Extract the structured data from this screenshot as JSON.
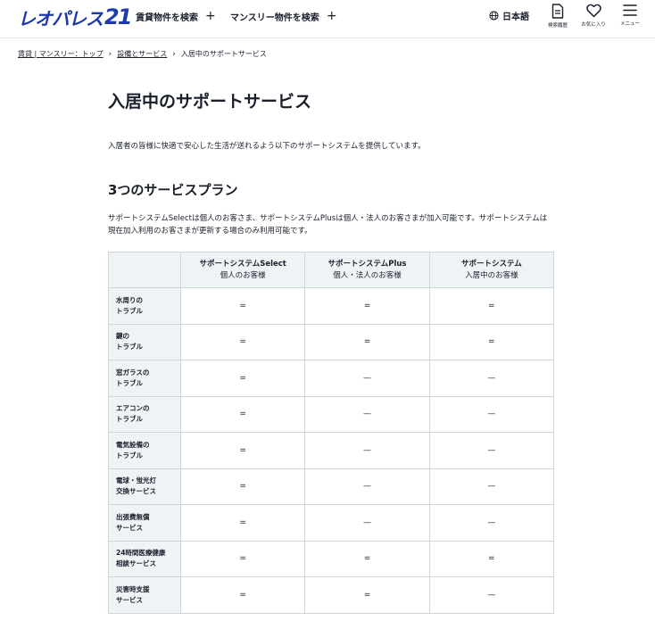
{
  "header": {
    "logo_text": "レオパレス",
    "logo_num": "21",
    "nav": [
      {
        "label": "賃貸物件を検索",
        "icon": "plus-icon",
        "plus": "+"
      },
      {
        "label": "マンスリー物件を検索",
        "icon": "plus-icon",
        "plus": "+"
      }
    ],
    "lang_label": "日本語",
    "icons": [
      {
        "name": "search-history-icon",
        "caption": "検索履歴"
      },
      {
        "name": "favorites-icon",
        "caption": "お気に入り"
      },
      {
        "name": "menu-icon",
        "caption": "メニュー"
      }
    ]
  },
  "breadcrumb": [
    {
      "label": "賃貸 | マンスリー：トップ",
      "link": true
    },
    {
      "label": "設備とサービス",
      "link": true
    },
    {
      "label": "入居中のサポートサービス",
      "link": false
    }
  ],
  "breadcrumb_sep": "›",
  "main": {
    "title": "入居中のサポートサービス",
    "intro": "入居者の皆様に快適で安心した生活が送れるよう以下のサポートシステムを提供しています。",
    "section_title": "3つのサービスプラン",
    "description": "サポートシステムSelectは個人のお客さま、サポートシステムPlusは個人・法人のお客さまが加入可能です。サポートシステムは現在加入利用のお客さまが更新する場合のみ利用可能です。"
  },
  "table": {
    "columns": [
      {
        "name": "サポートシステムSelect",
        "sub": "個人のお客様"
      },
      {
        "name": "サポートシステムPlus",
        "sub": "個人・法人のお客様"
      },
      {
        "name": "サポートシステム",
        "sub": "入居中のお客様"
      }
    ],
    "rows": [
      {
        "label": [
          "水周りの",
          "トラブル"
        ],
        "values": [
          "=",
          "=",
          "="
        ]
      },
      {
        "label": [
          "鍵の",
          "トラブル"
        ],
        "values": [
          "=",
          "=",
          "="
        ]
      },
      {
        "label": [
          "窓ガラスの",
          "トラブル"
        ],
        "values": [
          "=",
          "—",
          "—"
        ]
      },
      {
        "label": [
          "エアコンの",
          "トラブル"
        ],
        "values": [
          "=",
          "—",
          "—"
        ]
      },
      {
        "label": [
          "電気設備の",
          "トラブル"
        ],
        "values": [
          "=",
          "—",
          "—"
        ]
      },
      {
        "label": [
          "電球・蛍光灯",
          "交換サービス"
        ],
        "values": [
          "=",
          "—",
          "—"
        ]
      },
      {
        "label": [
          "出張費無償",
          "サービス"
        ],
        "values": [
          "=",
          "—",
          "—"
        ]
      },
      {
        "label": [
          "24時間医療健康",
          "相談サービス"
        ],
        "values": [
          "=",
          "=",
          "="
        ]
      },
      {
        "label": [
          "災害時支援",
          "サービス"
        ],
        "values": [
          "=",
          "=",
          "—"
        ]
      }
    ]
  },
  "colors": {
    "brand": "#1c3aa9",
    "table_header_bg": "#eef3f6",
    "border": "#cfd5dc",
    "text": "#1a1f2c"
  }
}
